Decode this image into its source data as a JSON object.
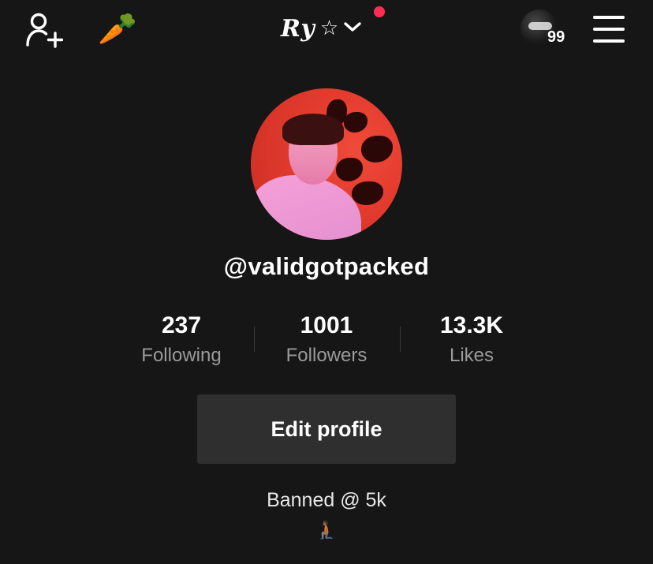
{
  "header": {
    "account_name": "Ry",
    "account_star": "☆",
    "add_friend_icon": "add-person-icon",
    "carrot_emoji": "🥕",
    "chevron_icon": "chevron-down-icon",
    "notification_dot_color": "#fe2c55",
    "mini_badge": "99",
    "menu_icon": "hamburger-menu-icon"
  },
  "profile": {
    "username": "@validgotpacked",
    "stats": [
      {
        "value": "237",
        "label": "Following"
      },
      {
        "value": "1001",
        "label": "Followers"
      },
      {
        "value": "13.3K",
        "label": "Likes"
      }
    ],
    "edit_button_label": "Edit profile",
    "bio": "Banned @ 5k",
    "bio_emoji": "🧎🏾"
  },
  "colors": {
    "background": "#161616",
    "button": "#2f2f2f",
    "secondary_text": "#9a9a9a",
    "avatar_red": "#e23b2e"
  }
}
